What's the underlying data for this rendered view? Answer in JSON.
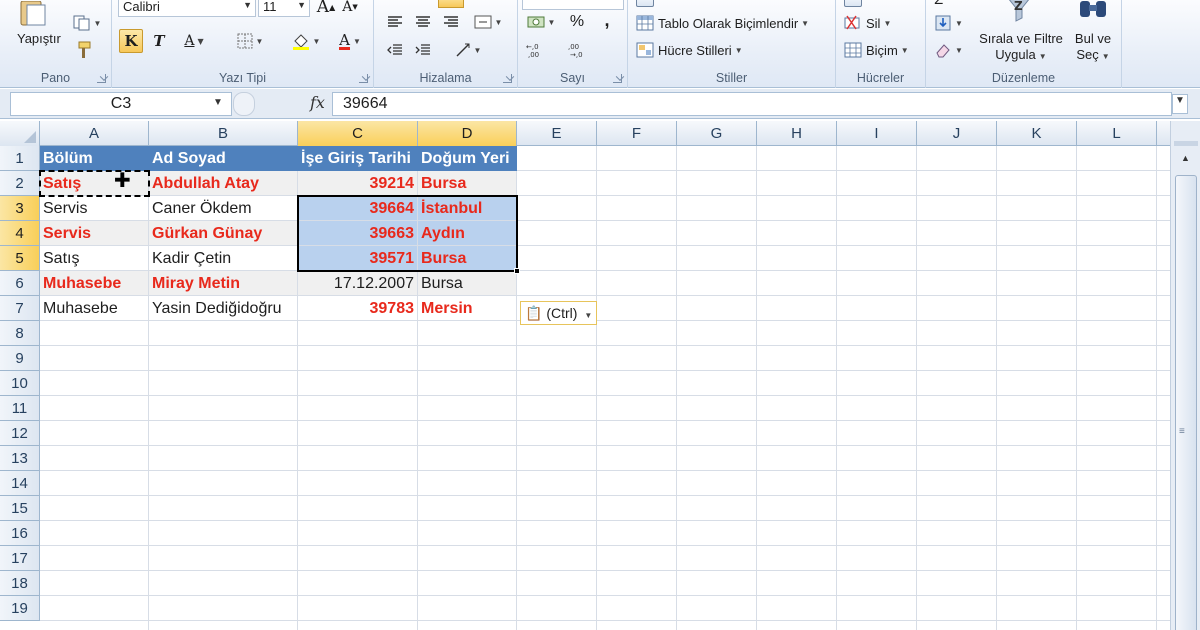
{
  "ribbon": {
    "clipboard": {
      "paste_label": "Yapıştır",
      "group_label": "Pano"
    },
    "font": {
      "font_name": "Calibri",
      "font_size": "11",
      "bold_label": "K",
      "italic_label": "T",
      "underline_label": "A",
      "group_label": "Yazı Tipi"
    },
    "alignment": {
      "group_label": "Hizalama"
    },
    "number": {
      "percent_label": "%",
      "comma_label": ",",
      "group_label": "Sayı"
    },
    "styles": {
      "format_table_label": "Tablo Olarak Biçimlendir",
      "cell_styles_label": "Hücre Stilleri",
      "group_label": "Stiller"
    },
    "cells": {
      "delete_label": "Sil",
      "format_label": "Biçim",
      "group_label": "Hücreler"
    },
    "editing": {
      "sort_filter_line1": "Sırala ve Filtre",
      "sort_filter_line2": "Uygula",
      "find_select_line1": "Bul ve",
      "find_select_line2": "Seç",
      "group_label": "Düzenleme"
    }
  },
  "formula_bar": {
    "name_box": "C3",
    "fx_label": "fx",
    "formula": "39664"
  },
  "columns": [
    "A",
    "B",
    "C",
    "D",
    "E",
    "F",
    "G",
    "H",
    "I",
    "J",
    "K",
    "L"
  ],
  "rows": [
    "1",
    "2",
    "3",
    "4",
    "5",
    "6",
    "7",
    "8",
    "9",
    "10",
    "11",
    "12",
    "13",
    "14",
    "15",
    "16",
    "17",
    "18",
    "19"
  ],
  "table": {
    "headers": [
      "Bölüm",
      "Ad Soyad",
      "İşe Giriş Tarihi",
      "Doğum Yeri"
    ],
    "rows": [
      [
        "Satış",
        "Abdullah Atay",
        "39214",
        "Bursa"
      ],
      [
        "Servis",
        "Caner Ökdem",
        "39664",
        "İstanbul"
      ],
      [
        "Servis",
        "Gürkan Günay",
        "39663",
        "Aydın"
      ],
      [
        "Satış",
        "Kadir Çetin",
        "39571",
        "Bursa"
      ],
      [
        "Muhasebe",
        "Miray Metin",
        "17.12.2007",
        "Bursa"
      ],
      [
        "Muhasebe",
        "Yasin Dediğidoğru",
        "39783",
        "Mersin"
      ]
    ]
  },
  "paste_options": {
    "label": "(Ctrl)"
  },
  "colors": {
    "header_fill": "#4f81bd",
    "header_text": "#ffffff",
    "highlight_text": "#e8291c",
    "selection_fill": "#b9d1ee",
    "selected_header": "#f9cf59"
  }
}
